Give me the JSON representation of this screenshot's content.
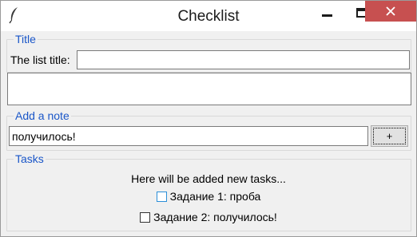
{
  "window": {
    "title": "Checklist",
    "icon": "feather-icon",
    "controls": [
      "minimize-icon",
      "maximize-icon",
      "close-icon"
    ]
  },
  "title_frame": {
    "label": "Title",
    "field_label": "The list title:",
    "field_value": ""
  },
  "note_frame": {
    "label": "Add a note",
    "input_value": "получилось!",
    "add_button_label": "+"
  },
  "tasks_frame": {
    "label": "Tasks",
    "header": "Here will be added new tasks...",
    "items": [
      {
        "label": "Задание 1: проба",
        "checked": false
      },
      {
        "label": "Задание 2: получилось!",
        "checked": false
      }
    ]
  },
  "colors": {
    "frame_label": "#1a56c8",
    "close_button": "#c75050",
    "window_bg": "#f0f0f0"
  }
}
